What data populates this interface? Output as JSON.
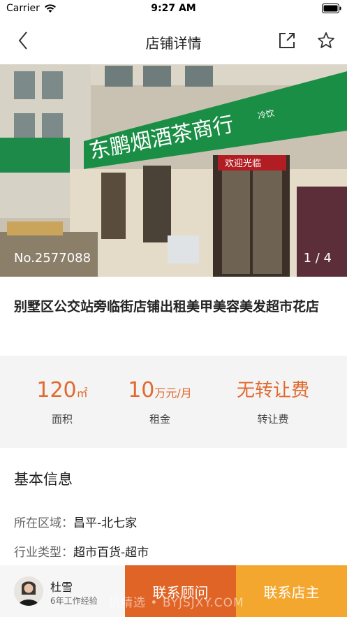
{
  "status_bar": {
    "carrier": "Carrier",
    "time": "9:27 AM"
  },
  "nav": {
    "title": "店铺详情",
    "back_icon": "chevron-left-icon",
    "share_icon": "share-icon",
    "favorite_icon": "star-icon"
  },
  "gallery": {
    "listing_no": "No.2577088",
    "counter": "1 / 4",
    "sign_main": "东鹏烟酒茶商行",
    "sign_sub": "冷饮",
    "shop_sign": "欢迎光临"
  },
  "listing": {
    "title": "别墅区公交站旁临街店铺出租美甲美容美发超市花店"
  },
  "stats": {
    "area": {
      "value": "120",
      "unit": "㎡",
      "label": "面积"
    },
    "rent": {
      "value": "10",
      "unit": "万元/月",
      "label": "租金"
    },
    "transfer": {
      "value": "无转让费",
      "label": "转让费"
    }
  },
  "basic_info": {
    "title": "基本信息",
    "rows": [
      {
        "key": "所在区域：",
        "value": "昌平-北七家"
      },
      {
        "key": "行业类型：",
        "value": "超市百货-超市"
      }
    ]
  },
  "agent": {
    "name": "杜雪",
    "experience": "6年工作经验"
  },
  "actions": {
    "contact_advisor": "联系顾问",
    "contact_owner": "联系店主"
  },
  "watermark": "机精选 • BYJSJXY.COM",
  "colors": {
    "accent_orange": "#e06426",
    "accent_yellow": "#f3a72e",
    "stat_text": "#e06a2f"
  }
}
